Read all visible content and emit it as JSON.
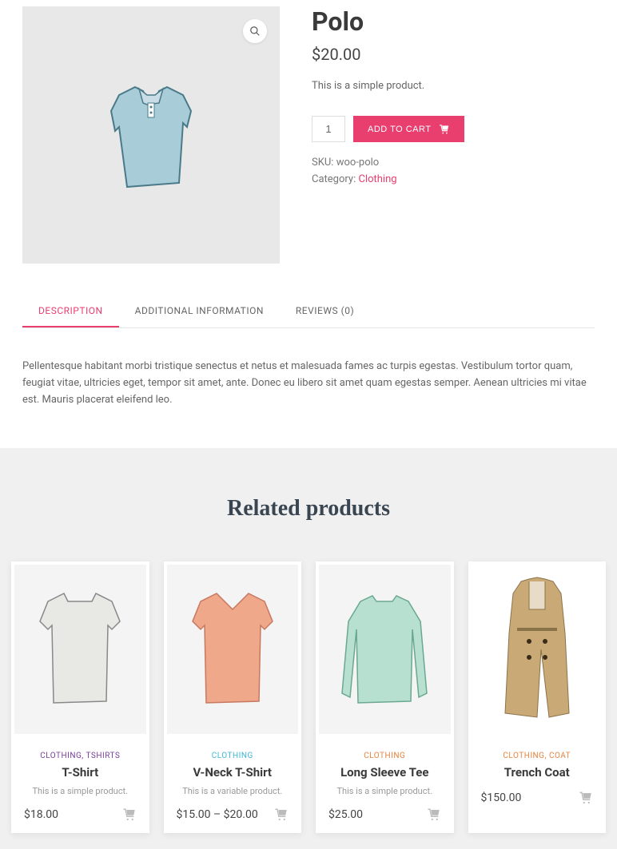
{
  "product": {
    "title": "Polo",
    "currency": "$",
    "price": "20.00",
    "short_desc": "This is a simple product.",
    "qty": "1",
    "add_to_cart": "ADD TO CART",
    "sku_label": "SKU:",
    "sku": "woo-polo",
    "category_label": "Category:",
    "category": "Clothing"
  },
  "tabs": {
    "description": "DESCRIPTION",
    "additional": "ADDITIONAL INFORMATION",
    "reviews": "REVIEWS (0)"
  },
  "description_content": "Pellentesque habitant morbi tristique senectus et netus et malesuada fames ac turpis egestas. Vestibulum tortor quam, feugiat vitae, ultricies eget, tempor sit amet, ante. Donec eu libero sit amet quam egestas semper. Aenean ultricies mi vitae est. Mauris placerat eleifend leo.",
  "related": {
    "heading": "Related products",
    "items": [
      {
        "cat": "CLOTHING, TSHIRTS",
        "cat_color": "#7a3e9d",
        "name": "T-Shirt",
        "desc": "This is a simple product.",
        "price": "$18.00"
      },
      {
        "cat": "CLOTHING",
        "cat_color": "#3fb8d6",
        "name": "V-Neck T-Shirt",
        "desc": "This is a variable product.",
        "price": "$15.00 – $20.00"
      },
      {
        "cat": "CLOTHING",
        "cat_color": "#e8843f",
        "name": "Long Sleeve Tee",
        "desc": "This is a simple product.",
        "price": "$25.00"
      },
      {
        "cat": "CLOTHING, COAT",
        "cat_color": "#e8843f",
        "name": "Trench Coat",
        "desc": "",
        "price": "$150.00"
      }
    ]
  }
}
